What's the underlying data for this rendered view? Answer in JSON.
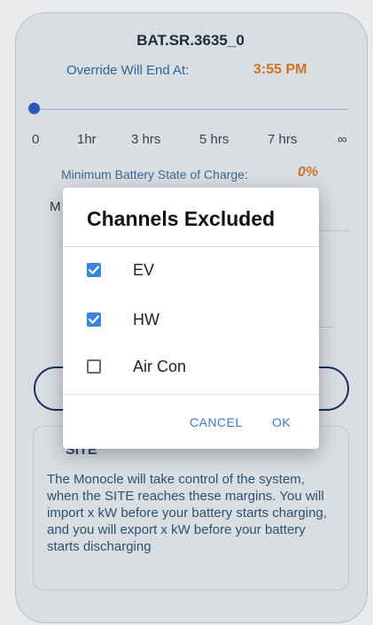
{
  "battery": {
    "name": "BAT.SR.3635_0"
  },
  "override": {
    "label": "Override Will End At:",
    "time": "3:55 PM"
  },
  "slider": {
    "value_fraction": 0,
    "ticks": [
      "0",
      "1hr",
      "3 hrs",
      "5 hrs",
      "7 hrs",
      "∞"
    ]
  },
  "min_soc": {
    "label": "Minimum Battery State of Charge:",
    "value": "0%"
  },
  "background_partial": {
    "letter": "M"
  },
  "site": {
    "title": "SITE",
    "description": "The Monocle will take control of the system, when the SITE reaches these margins. You will import x kW before your battery starts charging, and you will export x kW before your battery starts discharging"
  },
  "dialog": {
    "title": "Channels Excluded",
    "options": [
      {
        "label": "EV",
        "checked": true
      },
      {
        "label": "HW",
        "checked": true
      },
      {
        "label": "Air Con",
        "checked": false
      }
    ],
    "cancel_label": "CANCEL",
    "ok_label": "OK"
  },
  "colors": {
    "accent_orange": "#e07a1f",
    "checkbox_blue": "#3d82e2",
    "action_blue": "#3b78d1",
    "pill_border": "#1b2a63"
  }
}
